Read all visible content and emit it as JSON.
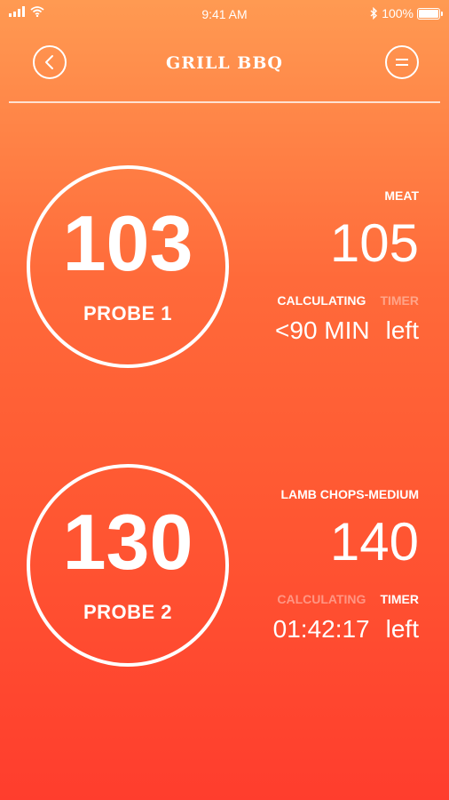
{
  "status_bar": {
    "time": "9:41 AM",
    "battery": "100%"
  },
  "header": {
    "title": "GRILL BBQ"
  },
  "probes": [
    {
      "temperature": "103",
      "label": "PROBE 1",
      "meat": "MEAT",
      "target": "105",
      "tab_calculating": "CALCULATING",
      "tab_timer": "TIMER",
      "active_tab": "calculating",
      "value": "<90 MIN",
      "suffix": "left"
    },
    {
      "temperature": "130",
      "label": "PROBE 2",
      "meat": "LAMB CHOPS-MEDIUM",
      "target": "140",
      "tab_calculating": "CALCULATING",
      "tab_timer": "TIMER",
      "active_tab": "timer",
      "value": "01:42:17",
      "suffix": "left"
    }
  ],
  "colors": {
    "gradient_top": "#ff9a52",
    "gradient_bottom": "#ff3d2d",
    "foreground": "#ffffff"
  }
}
